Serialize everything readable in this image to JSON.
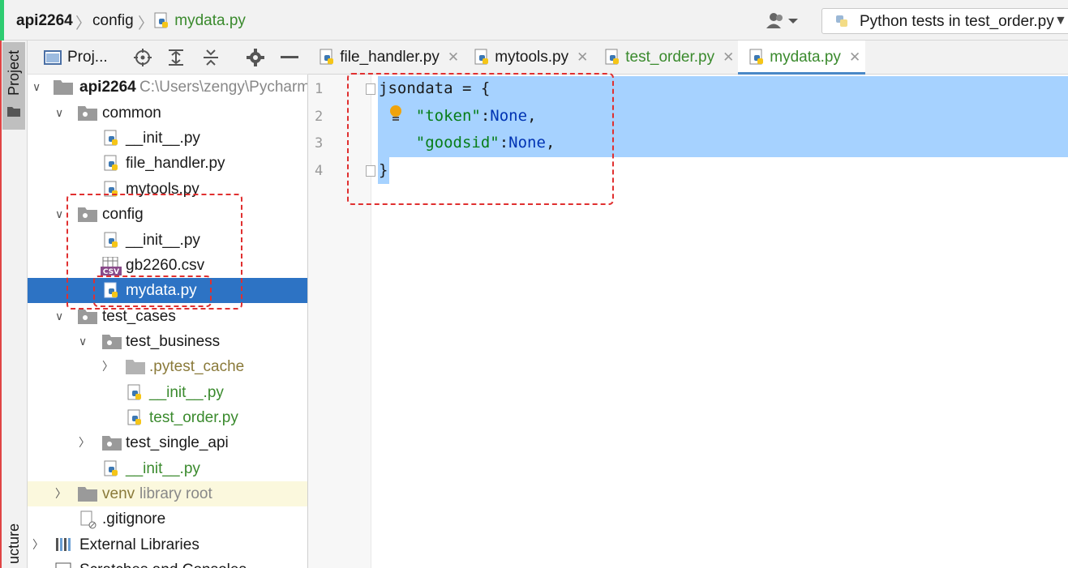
{
  "breadcrumb": {
    "project": "api2264",
    "folder": "config",
    "file": "mydata.py"
  },
  "run_config": {
    "label": "Python tests in test_order.py"
  },
  "tool_strip": {
    "project_tab": "Project",
    "structure_tab": "ucture"
  },
  "project_panel": {
    "title": "Proj..."
  },
  "tree": {
    "root_name": "api2264",
    "root_path": "C:\\Users\\zengy\\PycharmP",
    "common": "common",
    "common_init": "__init__.py",
    "common_file_handler": "file_handler.py",
    "common_mytools": "mytools.py",
    "config": "config",
    "config_init": "__init__.py",
    "config_csv": "gb2260.csv",
    "config_mydata": "mydata.py",
    "test_cases": "test_cases",
    "test_business": "test_business",
    "pytest_cache": ".pytest_cache",
    "tb_init": "__init__.py",
    "test_order": "test_order.py",
    "test_single_api": "test_single_api",
    "tc_init": "__init__.py",
    "venv": "venv",
    "venv_note": "library root",
    "gitignore": ".gitignore",
    "external_libraries": "External Libraries",
    "scratches": "Scratches and Consoles"
  },
  "tabs": [
    {
      "label": "file_handler.py"
    },
    {
      "label": "mytools.py"
    },
    {
      "label": "test_order.py"
    },
    {
      "label": "mydata.py"
    }
  ],
  "editor": {
    "line_numbers": [
      "1",
      "2",
      "3",
      "4"
    ],
    "line1": "jsondata = {",
    "line2_key": "\"token\"",
    "line2_val": "None",
    "line3_key": "\"goodsid\"",
    "line3_val": "None",
    "line4": "}"
  },
  "colors": {
    "selection": "#2d73c4",
    "editor_selection": "#a6d2ff",
    "annotation": "#e03030",
    "string": "#067d17",
    "keyword": "#0033b3"
  }
}
